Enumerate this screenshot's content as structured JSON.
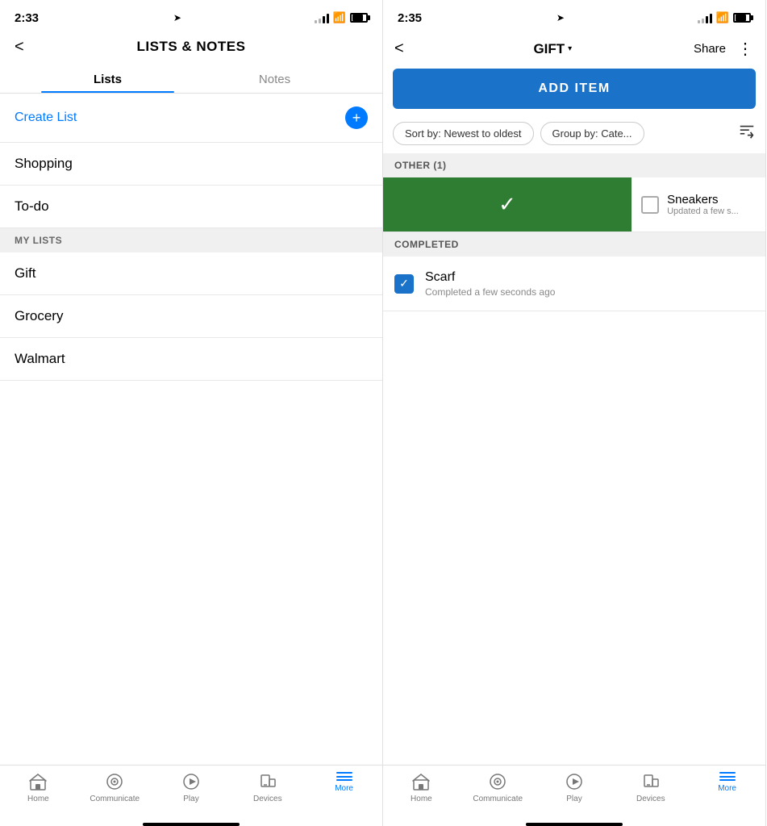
{
  "left": {
    "status": {
      "time": "2:33",
      "location": true
    },
    "header": {
      "title": "LISTS & NOTES",
      "back": "<"
    },
    "tabs": [
      {
        "label": "Lists",
        "active": true
      },
      {
        "label": "Notes",
        "active": false
      }
    ],
    "create_list": {
      "text": "Create List",
      "plus": "+"
    },
    "items": [
      {
        "label": "Shopping"
      },
      {
        "label": "To-do"
      }
    ],
    "my_lists_label": "MY LISTS",
    "my_lists": [
      {
        "label": "Gift"
      },
      {
        "label": "Grocery"
      },
      {
        "label": "Walmart"
      }
    ],
    "nav": {
      "items": [
        {
          "label": "Home",
          "icon": "home"
        },
        {
          "label": "Communicate",
          "icon": "communicate"
        },
        {
          "label": "Play",
          "icon": "play"
        },
        {
          "label": "Devices",
          "icon": "devices"
        },
        {
          "label": "More",
          "icon": "more",
          "active": true
        }
      ]
    }
  },
  "right": {
    "status": {
      "time": "2:35",
      "location": true
    },
    "header": {
      "back": "<",
      "title": "GIFT",
      "dropdown": "▾",
      "share": "Share",
      "more": "⋮"
    },
    "add_item_btn": "ADD ITEM",
    "filters": [
      {
        "label": "Sort by: Newest to oldest"
      },
      {
        "label": "Group by: Cate..."
      }
    ],
    "sort_icon": "↓≡",
    "sections": [
      {
        "label": "OTHER (1)",
        "items": [
          {
            "name": "Sneakers",
            "meta": "Updated a few s...",
            "swiped": true,
            "checked": false
          }
        ]
      },
      {
        "label": "COMPLETED",
        "items": [
          {
            "name": "Scarf",
            "meta": "Completed a few seconds ago",
            "swiped": false,
            "checked": true
          }
        ]
      }
    ],
    "nav": {
      "items": [
        {
          "label": "Home",
          "icon": "home"
        },
        {
          "label": "Communicate",
          "icon": "communicate"
        },
        {
          "label": "Play",
          "icon": "play"
        },
        {
          "label": "Devices",
          "icon": "devices"
        },
        {
          "label": "More",
          "icon": "more",
          "active": true
        }
      ]
    }
  }
}
